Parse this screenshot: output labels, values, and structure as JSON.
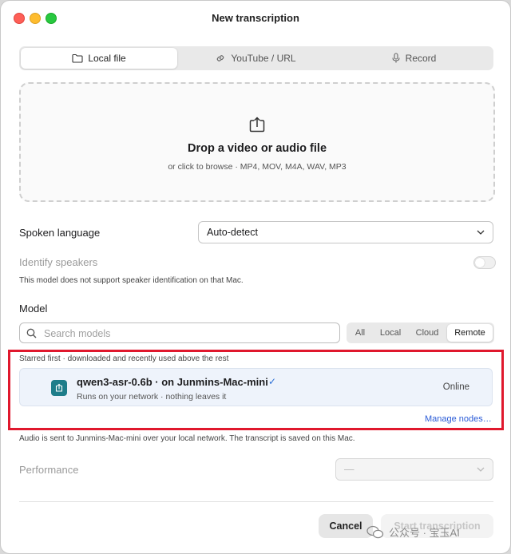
{
  "window": {
    "title": "New transcription"
  },
  "source_tabs": [
    {
      "label": "Local file",
      "icon": "folder-icon",
      "active": true
    },
    {
      "label": "YouTube / URL",
      "icon": "link-icon",
      "active": false
    },
    {
      "label": "Record",
      "icon": "microphone-icon",
      "active": false
    }
  ],
  "dropzone": {
    "icon": "upload-icon",
    "title": "Drop a video or audio file",
    "subtitle": "or click to browse · MP4, MOV, M4A, WAV, MP3"
  },
  "language": {
    "label": "Spoken language",
    "value": "Auto-detect"
  },
  "speakers": {
    "label": "Identify speakers",
    "enabled": false,
    "note": "This model does not support speaker identification on that Mac."
  },
  "model": {
    "heading": "Model",
    "search_placeholder": "Search models",
    "filters": [
      "All",
      "Local",
      "Cloud",
      "Remote"
    ],
    "active_filter": "Remote",
    "sort_note": "Starred first · downloaded and recently used above the rest",
    "selected": {
      "name": "qwen3-asr-0.6b · on Junmins-Mac-mini",
      "check": "✓",
      "subtitle": "Runs on your network · nothing leaves it",
      "status": "Online"
    },
    "manage_link": "Manage nodes…",
    "privacy_note": "Audio is sent to Junmins-Mac-mini over your local network. The transcript is saved on this Mac."
  },
  "performance": {
    "label": "Performance",
    "value": "—"
  },
  "buttons": {
    "cancel": "Cancel",
    "start": "Start transcription"
  },
  "watermark": "公众号 · 宝玉AI",
  "colors": {
    "accent": "#2a5bd7",
    "highlight": "#e0182d",
    "model_icon": "#1e7d8a"
  }
}
